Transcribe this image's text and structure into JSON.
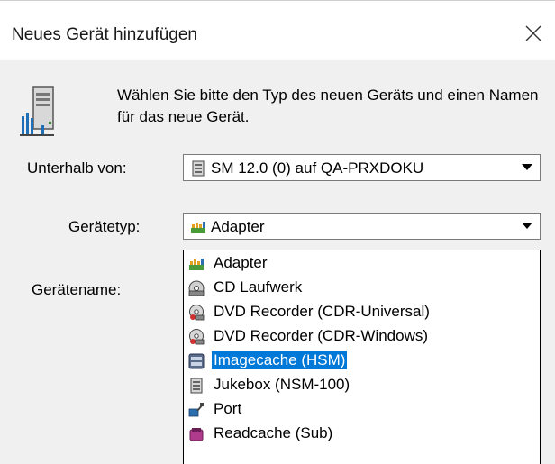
{
  "dialog": {
    "title": "Neues Gerät hinzufügen",
    "intro": "Wählen Sie bitte den Typ des neuen Geräts und einen Namen für das neue Gerät."
  },
  "form": {
    "parent_label": "Unterhalb von:",
    "parent_value": "SM 12.0 (0) auf QA-PRXDOKU",
    "type_label": "Gerätetyp:",
    "type_value": "Adapter",
    "name_label": "Gerätename:"
  },
  "device_types": [
    {
      "label": "Adapter",
      "icon": "adapter-icon"
    },
    {
      "label": "CD Laufwerk",
      "icon": "cd-drive-icon"
    },
    {
      "label": "DVD Recorder (CDR-Universal)",
      "icon": "dvd-recorder-icon"
    },
    {
      "label": "DVD Recorder (CDR-Windows)",
      "icon": "dvd-recorder-icon"
    },
    {
      "label": "Imagecache (HSM)",
      "icon": "hsm-icon",
      "selected": true
    },
    {
      "label": "Jukebox (NSM-100)",
      "icon": "jukebox-icon"
    },
    {
      "label": "Port",
      "icon": "port-icon"
    },
    {
      "label": "Readcache (Sub)",
      "icon": "readcache-icon"
    }
  ],
  "colors": {
    "selection": "#0078d7",
    "dialog_background": "#f0f0f0"
  }
}
